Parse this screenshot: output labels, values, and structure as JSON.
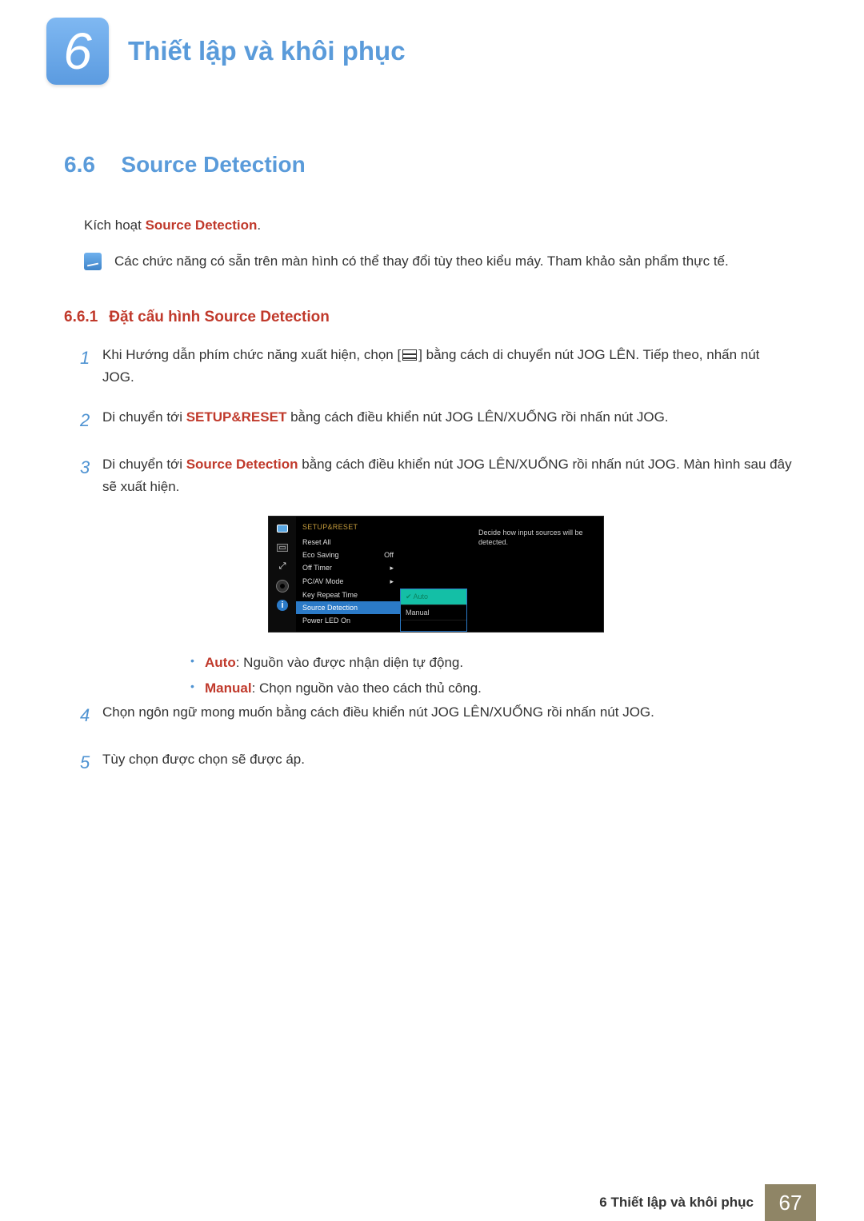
{
  "chapter": {
    "number": "6",
    "title": "Thiết lập và khôi phục"
  },
  "section": {
    "number": "6.6",
    "title": "Source Detection"
  },
  "intro": {
    "prefix": "Kích hoạt ",
    "bold": "Source Detection",
    "suffix": "."
  },
  "note": "Các chức năng có sẵn trên màn hình có thể thay đổi tùy theo kiểu máy. Tham khảo sản phẩm thực tế.",
  "subsection": {
    "number": "6.6.1",
    "title": "Đặt cấu hình Source Detection"
  },
  "steps": {
    "s1_a": "Khi Hướng dẫn phím chức năng xuất hiện, chọn [",
    "s1_b": "] bằng cách di chuyển nút JOG LÊN. Tiếp theo, nhấn nút JOG.",
    "s2_a": "Di chuyển tới ",
    "s2_bold": "SETUP&RESET",
    "s2_b": " bằng cách điều khiển nút JOG LÊN/XUỐNG rồi nhấn nút JOG.",
    "s3_a": "Di chuyển tới ",
    "s3_bold": "Source Detection",
    "s3_b": " bằng cách điều khiển nút JOG LÊN/XUỐNG rồi nhấn nút JOG. Màn hình sau đây sẽ xuất hiện.",
    "s4": "Chọn ngôn ngữ mong muốn bằng cách điều khiển nút JOG LÊN/XUỐNG rồi nhấn nút JOG.",
    "s5": "Tùy chọn được chọn sẽ được áp."
  },
  "osd": {
    "header": "SETUP&RESET",
    "items": [
      "Reset All",
      "Eco Saving",
      "Off Timer",
      "PC/AV Mode",
      "Key Repeat Time",
      "Source Detection",
      "Power LED On"
    ],
    "values": [
      "",
      "Off",
      "▸",
      "▸",
      "",
      "",
      ""
    ],
    "options": [
      "Auto",
      "Manual"
    ],
    "description": "Decide how input sources will be detected."
  },
  "bullets": {
    "b1_bold": "Auto",
    "b1_text": ": Nguồn vào được nhận diện tự động.",
    "b2_bold": "Manual",
    "b2_text": ": Chọn nguồn vào theo cách thủ công."
  },
  "footer": {
    "label": "6 Thiết lập và khôi phục",
    "page": "67"
  }
}
